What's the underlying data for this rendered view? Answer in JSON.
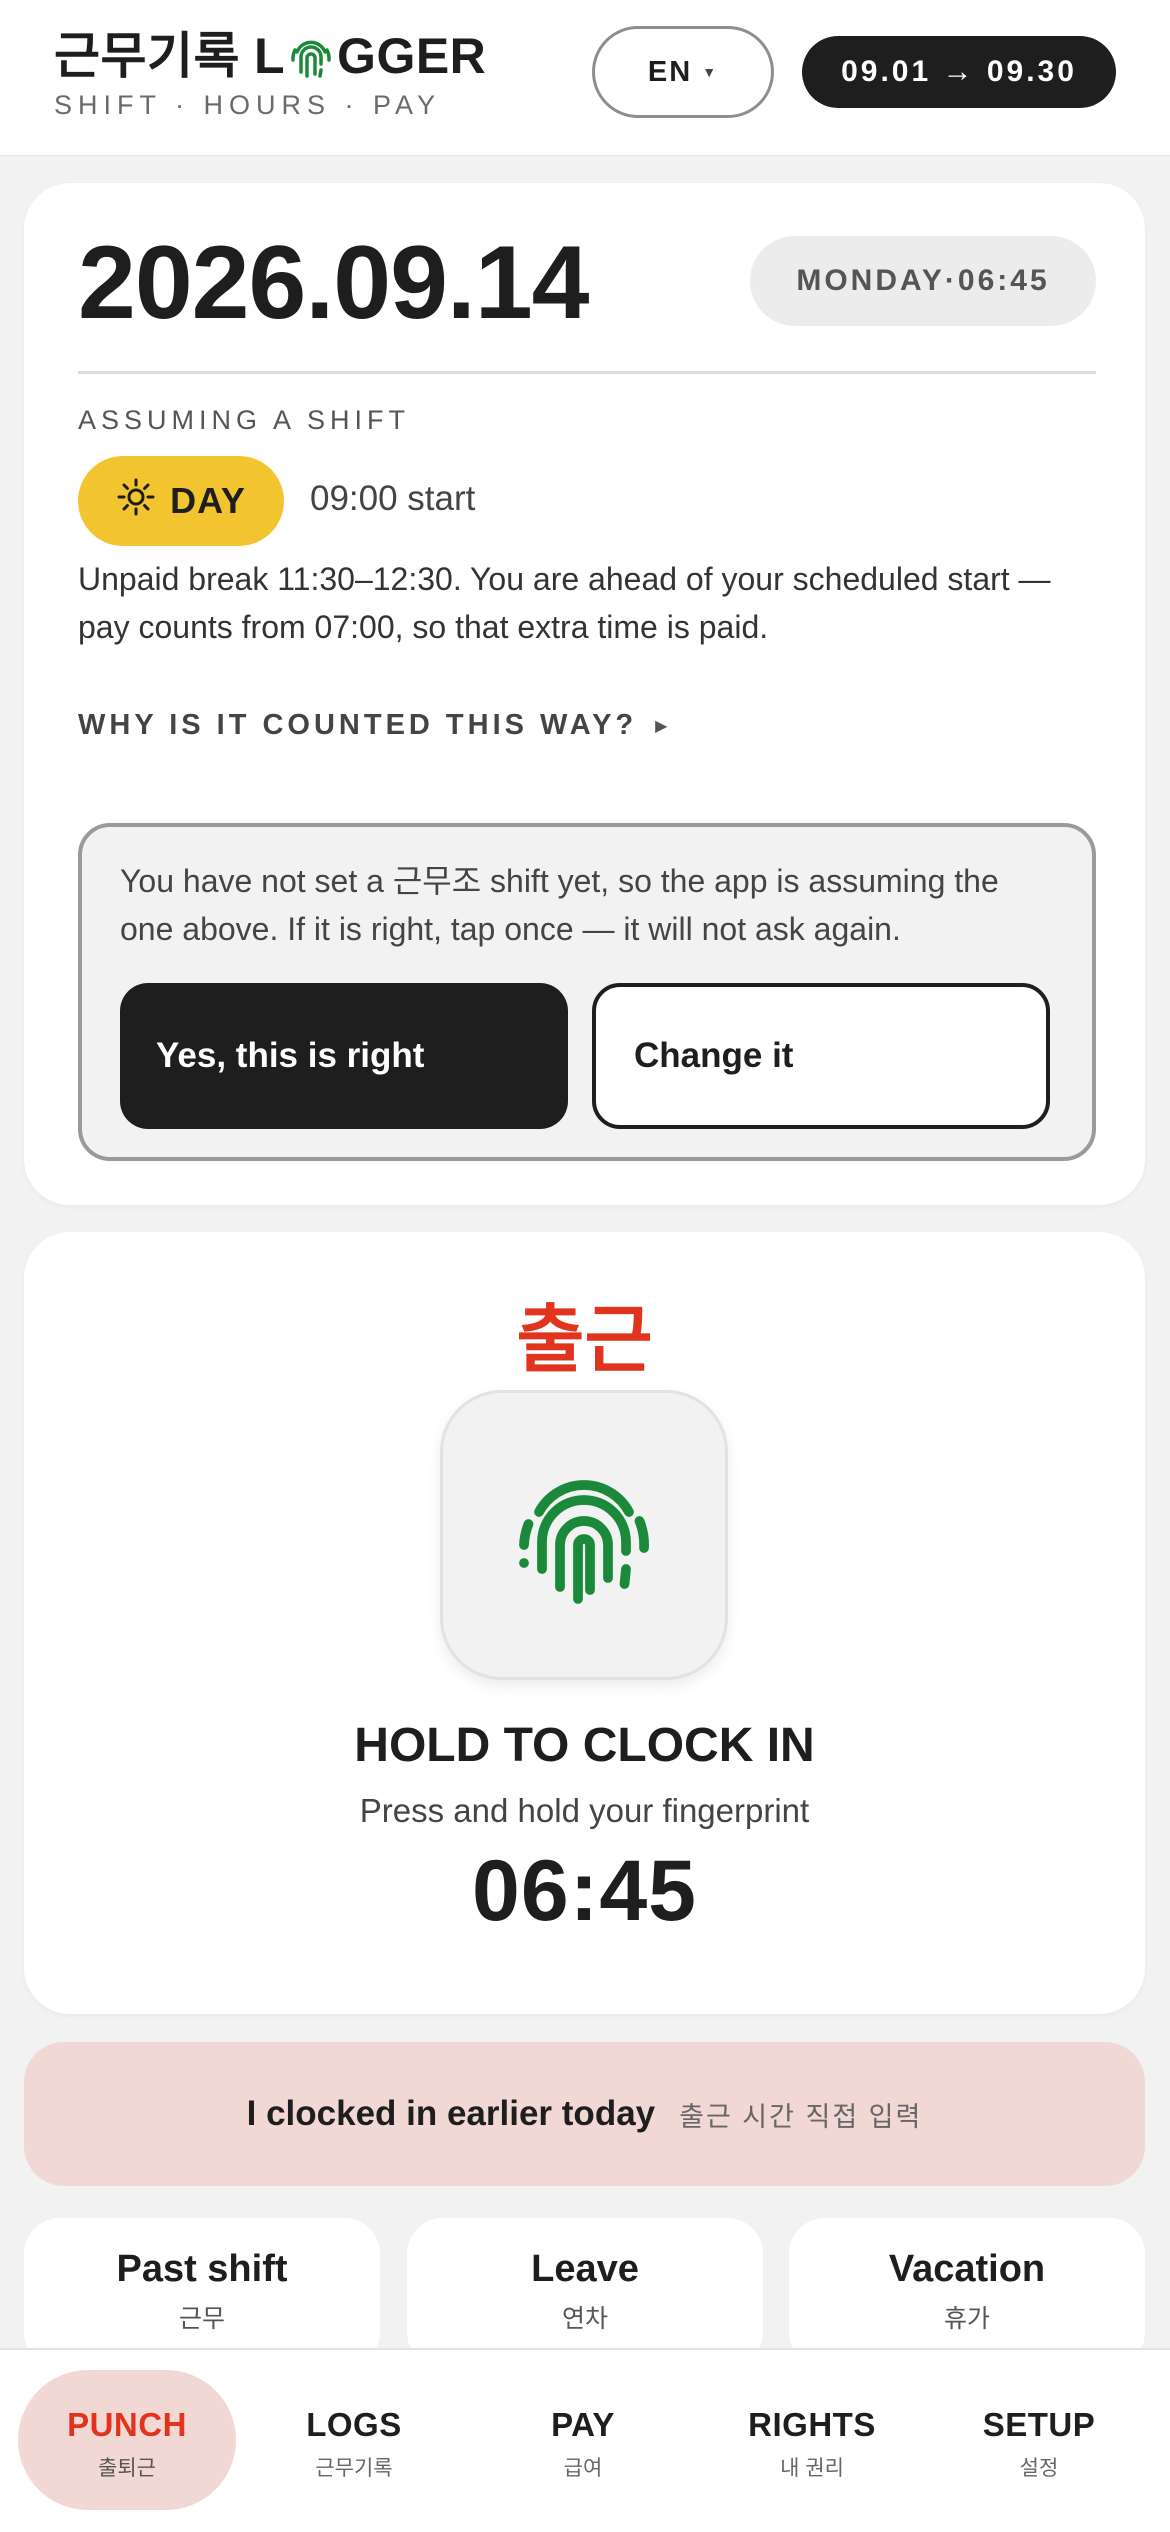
{
  "header": {
    "brand_prefix": "근무기록",
    "brand_l": "L",
    "brand_suffix": "GGER",
    "brand_tagline": "SHIFT · HOURS · PAY",
    "language": "EN",
    "period": "09.01 → 09.30"
  },
  "today": {
    "date": "2026.09.14",
    "weekday_time": "MONDAY·06:45",
    "assume_label": "ASSUMING A SHIFT",
    "shift_name": "DAY",
    "shift_start": "09:00 start",
    "break_note": "Unpaid break 11:30–12:30. You are ahead of your scheduled start — pay counts from 07:00, so that extra time is paid.",
    "why_link": "WHY IS IT COUNTED THIS WAY?",
    "confirm_text": "You have not set a 근무조 shift yet, so the app is assuming the one above. If it is right, tap once — it will not ask again.",
    "confirm_yes": "Yes, this is right",
    "confirm_change": "Change it"
  },
  "punch": {
    "title": "출근",
    "hold_label": "HOLD TO CLOCK IN",
    "hold_hint": "Press and hold your fingerprint",
    "time": "06:45"
  },
  "earlier": {
    "label": "I clocked in earlier today",
    "sub": "출근 시간 직접 입력"
  },
  "quick_actions": [
    {
      "label": "Past shift",
      "sub": "근무"
    },
    {
      "label": "Leave",
      "sub": "연차"
    },
    {
      "label": "Vacation",
      "sub": "휴가"
    }
  ],
  "nav": [
    {
      "label": "PUNCH",
      "sub": "출퇴근",
      "active": true
    },
    {
      "label": "LOGS",
      "sub": "근무기록"
    },
    {
      "label": "PAY",
      "sub": "급여"
    },
    {
      "label": "RIGHTS",
      "sub": "내 권리"
    },
    {
      "label": "SETUP",
      "sub": "설정"
    }
  ],
  "colors": {
    "accent_red": "#e0341e",
    "fingerprint_green": "#1a8a3a",
    "day_yellow": "#f2c530",
    "ink": "#1e1e1e",
    "soft_pink": "#f2d8d4"
  },
  "icons": {
    "logo_o": "fingerprint-icon",
    "lang_caret": "caret-down-icon",
    "shift": "sun-icon",
    "why": "triangle-right-icon",
    "punch": "fingerprint-icon"
  }
}
